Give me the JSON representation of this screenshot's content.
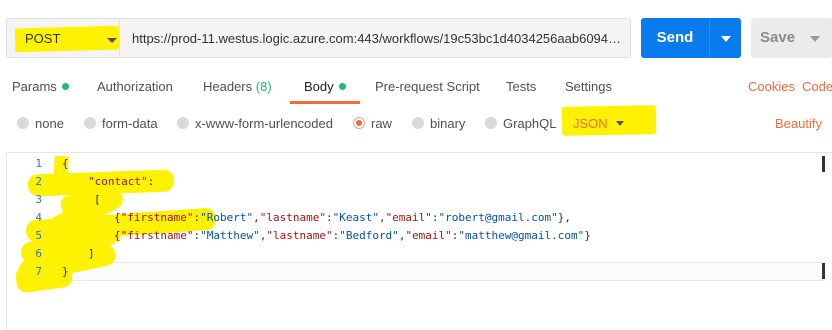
{
  "request": {
    "method": "POST",
    "url": "https://prod-11.westus.logic.azure.com:443/workflows/19c53bc1d4034256aab60949...",
    "send_label": "Send",
    "save_label": "Save"
  },
  "tabs": [
    {
      "label": "Params",
      "indicator": "dot"
    },
    {
      "label": "Authorization"
    },
    {
      "label": "Headers",
      "count": "(8)"
    },
    {
      "label": "Body",
      "indicator": "dot",
      "active": true
    },
    {
      "label": "Pre-request Script"
    },
    {
      "label": "Tests"
    },
    {
      "label": "Settings"
    }
  ],
  "links": {
    "cookies": "Cookies",
    "code": "Code",
    "beautify": "Beautify"
  },
  "body_types": [
    {
      "label": "none"
    },
    {
      "label": "form-data"
    },
    {
      "label": "x-www-form-urlencoded"
    },
    {
      "label": "raw",
      "selected": true
    },
    {
      "label": "binary"
    },
    {
      "label": "GraphQL"
    }
  ],
  "format": "JSON",
  "editor": {
    "line_numbers": [
      "1",
      "2",
      "3",
      "4",
      "5",
      "6",
      "7"
    ],
    "lines": [
      [
        {
          "t": "p",
          "v": "{"
        }
      ],
      [
        {
          "t": "k",
          "v": "\"contact\""
        },
        {
          "t": "p",
          "v": ":"
        }
      ],
      [
        {
          "t": "p",
          "v": "["
        }
      ],
      [
        {
          "t": "p",
          "v": "{"
        },
        {
          "t": "k",
          "v": "\"firstname\""
        },
        {
          "t": "p",
          "v": ":"
        },
        {
          "t": "s",
          "v": "\"Robert\""
        },
        {
          "t": "p",
          "v": ","
        },
        {
          "t": "k",
          "v": "\"lastname\""
        },
        {
          "t": "p",
          "v": ":"
        },
        {
          "t": "s",
          "v": "\"Keast\""
        },
        {
          "t": "p",
          "v": ","
        },
        {
          "t": "k",
          "v": "\"email\""
        },
        {
          "t": "p",
          "v": ":"
        },
        {
          "t": "s",
          "v": "\"robert@gmail.com\""
        },
        {
          "t": "p",
          "v": "},"
        }
      ],
      [
        {
          "t": "p",
          "v": "{"
        },
        {
          "t": "k",
          "v": "\"firstname\""
        },
        {
          "t": "p",
          "v": ":"
        },
        {
          "t": "s",
          "v": "\"Matthew\""
        },
        {
          "t": "p",
          "v": ","
        },
        {
          "t": "k",
          "v": "\"lastname\""
        },
        {
          "t": "p",
          "v": ":"
        },
        {
          "t": "s",
          "v": "\"Bedford\""
        },
        {
          "t": "p",
          "v": ","
        },
        {
          "t": "k",
          "v": "\"email\""
        },
        {
          "t": "p",
          "v": ":"
        },
        {
          "t": "s",
          "v": "\"matthew@gmail.com\""
        },
        {
          "t": "p",
          "v": "}"
        }
      ],
      [
        {
          "t": "p",
          "v": "]"
        }
      ],
      [
        {
          "t": "p",
          "v": "}"
        }
      ]
    ]
  },
  "colors": {
    "accent": "#f26b3a",
    "send": "#097bed",
    "dot": "#26b47f",
    "highlight": "#fff200"
  }
}
